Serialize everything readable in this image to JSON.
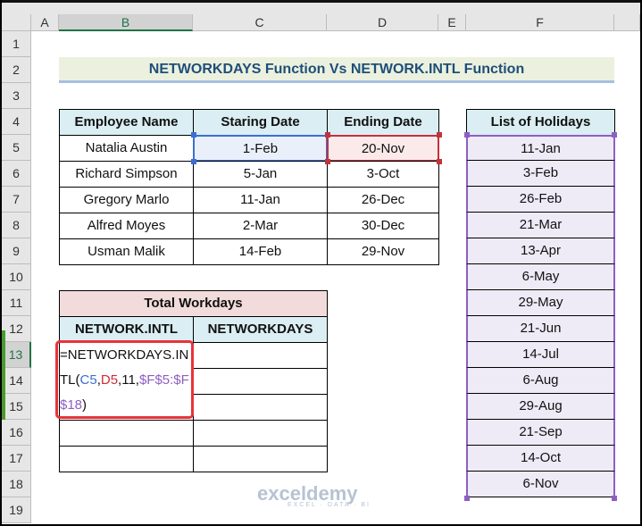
{
  "columns": [
    "A",
    "B",
    "C",
    "D",
    "E",
    "F"
  ],
  "rows": [
    "1",
    "2",
    "3",
    "4",
    "5",
    "6",
    "7",
    "8",
    "9",
    "10",
    "11",
    "12",
    "13",
    "14",
    "15",
    "16",
    "17",
    "18",
    "19"
  ],
  "title": "NETWORKDAYS Function Vs NETWORK.INTL Function",
  "employee_table": {
    "headers": [
      "Employee Name",
      "Staring Date",
      "Ending Date"
    ],
    "rows": [
      [
        "Natalia Austin",
        "1-Feb",
        "20-Nov"
      ],
      [
        "Richard Simpson",
        "5-Jan",
        "3-Oct"
      ],
      [
        "Gregory Marlo",
        "11-Jan",
        "26-Dec"
      ],
      [
        "Alfred Moyes",
        "2-Mar",
        "30-Dec"
      ],
      [
        "Usman Malik",
        "14-Feb",
        "29-Nov"
      ]
    ]
  },
  "holidays": {
    "header": "List of Holidays",
    "items": [
      "11-Jan",
      "3-Feb",
      "26-Feb",
      "21-Mar",
      "13-Apr",
      "6-May",
      "29-May",
      "21-Jun",
      "14-Jul",
      "6-Aug",
      "29-Aug",
      "21-Sep",
      "14-Oct",
      "6-Nov"
    ]
  },
  "workdays_table": {
    "title": "Total Workdays",
    "headers": [
      "NETWORK.INTL",
      "NETWORKDAYS"
    ]
  },
  "formula": {
    "parts": [
      {
        "text": "=NETWORKDAYS.INTL(",
        "color": "#111111"
      },
      {
        "text": "C5",
        "color": "#3b6fd1"
      },
      {
        "text": ",",
        "color": "#111111"
      },
      {
        "text": "D5",
        "color": "#d12b36"
      },
      {
        "text": ",11,",
        "color": "#111111"
      },
      {
        "text": "$F$5:$F$18",
        "color": "#8e5fc2"
      },
      {
        "text": ")",
        "color": "#111111"
      }
    ]
  },
  "colors": {
    "ref_c5": "#3b6fd1",
    "ref_d5": "#c0333d",
    "ref_holidays": "#8e5fc2",
    "highlight": "#e8333b"
  },
  "watermark": {
    "name": "exceldemy",
    "tagline": "EXCEL · DATA · BI"
  }
}
